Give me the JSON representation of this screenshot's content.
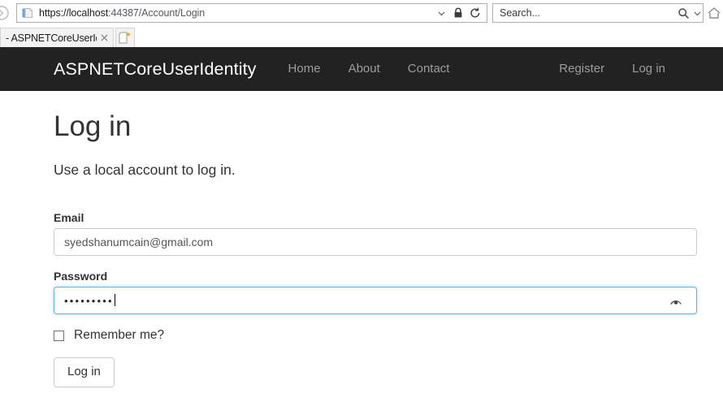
{
  "browser": {
    "back_forward_icon": "forward-arrow-icon",
    "page_icon": "page-document-icon",
    "url_host": "https://localhost",
    "url_path": ":44387/Account/Login",
    "url_full": "https://localhost:44387/Account/Login",
    "url_dropdown_icon": "chevron-down-icon",
    "security_icon": "lock-icon",
    "refresh_icon": "refresh-icon",
    "home_icon": "home-icon",
    "search": {
      "placeholder": "Search...",
      "search_icon": "search-icon",
      "dropdown_icon": "chevron-down-icon"
    },
    "tab": {
      "title": "- ASPNETCoreUserId...",
      "close_icon": "close-icon"
    },
    "new_tab": {
      "label": "",
      "icon": "new-tab-icon"
    }
  },
  "navbar": {
    "brand": "ASPNETCoreUserIdentity",
    "left_links": [
      {
        "label": "Home"
      },
      {
        "label": "About"
      },
      {
        "label": "Contact"
      }
    ],
    "right_links": [
      {
        "label": "Register"
      },
      {
        "label": "Log in"
      }
    ],
    "background_color": "#222222",
    "brand_color": "#ffffff",
    "link_color": "#9d9d9d"
  },
  "main": {
    "title": "Log in",
    "subtitle": "Use a local account to log in.",
    "form": {
      "email": {
        "label": "Email",
        "value": "syedshanumcain@gmail.com",
        "placeholder": ""
      },
      "password": {
        "label": "Password",
        "value": "•••••••••",
        "placeholder": "",
        "focused": true,
        "reveal_icon": "eye-reveal-password-icon"
      },
      "remember_me": {
        "label": "Remember me?",
        "checked": false
      },
      "submit": {
        "label": "Log in"
      }
    },
    "accent_focus_color": "#66afe9",
    "text_color": "#333333"
  }
}
